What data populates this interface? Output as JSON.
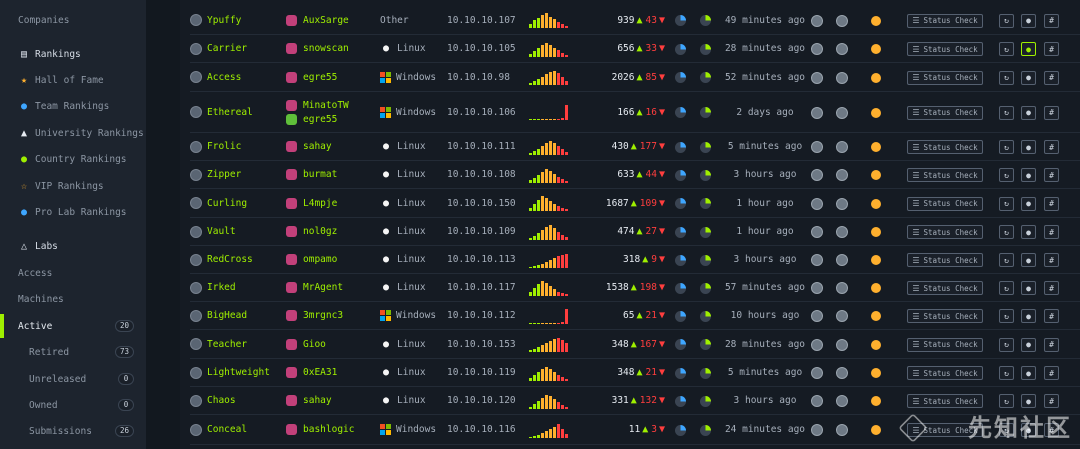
{
  "sidebar": {
    "companies": "Companies",
    "rankings": "Rankings",
    "hall_of_fame": "Hall of Fame",
    "team_rankings": "Team Rankings",
    "university_rankings": "University Rankings",
    "country_rankings": "Country Rankings",
    "vip_rankings": "VIP Rankings",
    "pro_lab_rankings": "Pro Lab Rankings",
    "labs": "Labs",
    "access": "Access",
    "machines": "Machines",
    "active": "Active",
    "active_count": "20",
    "retired": "Retired",
    "retired_count": "73",
    "unreleased": "Unreleased",
    "unreleased_count": "0",
    "owned": "Owned",
    "owned_count": "0",
    "submissions": "Submissions",
    "submissions_count": "26"
  },
  "status_check_label": "Status Check",
  "colors": {
    "accent": "#9fef00",
    "down": "#ff3e3e",
    "dot": "#ffb02e"
  },
  "machines": [
    {
      "name": "Ypuffy",
      "makers": [
        "AuxSarge"
      ],
      "os": "Other",
      "ip": "10.10.10.107",
      "up": "939",
      "down": "43",
      "released": "49 minutes ago"
    },
    {
      "name": "Carrier",
      "makers": [
        "snowscan"
      ],
      "os": "Linux",
      "ip": "10.10.10.105",
      "up": "656",
      "down": "33",
      "released": "28 minutes ago"
    },
    {
      "name": "Access",
      "makers": [
        "egre55"
      ],
      "os": "Windows",
      "ip": "10.10.10.98",
      "up": "2026",
      "down": "85",
      "released": "52 minutes ago"
    },
    {
      "name": "Ethereal",
      "makers": [
        "MinatoTW",
        "egre55"
      ],
      "os": "Windows",
      "ip": "10.10.10.106",
      "up": "166",
      "down": "16",
      "released": "2 days ago"
    },
    {
      "name": "Frolic",
      "makers": [
        "sahay"
      ],
      "os": "Linux",
      "ip": "10.10.10.111",
      "up": "430",
      "down": "177",
      "released": "5 minutes ago"
    },
    {
      "name": "Zipper",
      "makers": [
        "burmat"
      ],
      "os": "Linux",
      "ip": "10.10.10.108",
      "up": "633",
      "down": "44",
      "released": "3 hours ago"
    },
    {
      "name": "Curling",
      "makers": [
        "L4mpje"
      ],
      "os": "Linux",
      "ip": "10.10.10.150",
      "up": "1687",
      "down": "109",
      "released": "1 hour ago"
    },
    {
      "name": "Vault",
      "makers": [
        "nol0gz"
      ],
      "os": "Linux",
      "ip": "10.10.10.109",
      "up": "474",
      "down": "27",
      "released": "1 hour ago"
    },
    {
      "name": "RedCross",
      "makers": [
        "ompamo"
      ],
      "os": "Linux",
      "ip": "10.10.10.113",
      "up": "318",
      "down": "9",
      "released": "3 hours ago"
    },
    {
      "name": "Irked",
      "makers": [
        "MrAgent"
      ],
      "os": "Linux",
      "ip": "10.10.10.117",
      "up": "1538",
      "down": "198",
      "released": "57 minutes ago"
    },
    {
      "name": "BigHead",
      "makers": [
        "3mrgnc3"
      ],
      "os": "Windows",
      "ip": "10.10.10.112",
      "up": "65",
      "down": "21",
      "released": "10 hours ago"
    },
    {
      "name": "Teacher",
      "makers": [
        "Gioo"
      ],
      "os": "Linux",
      "ip": "10.10.10.153",
      "up": "348",
      "down": "167",
      "released": "28 minutes ago"
    },
    {
      "name": "Lightweight",
      "makers": [
        "0xEA31"
      ],
      "os": "Linux",
      "ip": "10.10.10.119",
      "up": "348",
      "down": "21",
      "released": "5 minutes ago"
    },
    {
      "name": "Chaos",
      "makers": [
        "sahay"
      ],
      "os": "Linux",
      "ip": "10.10.10.120",
      "up": "331",
      "down": "132",
      "released": "3 hours ago"
    },
    {
      "name": "Conceal",
      "makers": [
        "bashlogic"
      ],
      "os": "Windows",
      "ip": "10.10.10.116",
      "up": "11",
      "down": "3",
      "released": "24 minutes ago"
    }
  ],
  "watermark": "先知社区"
}
